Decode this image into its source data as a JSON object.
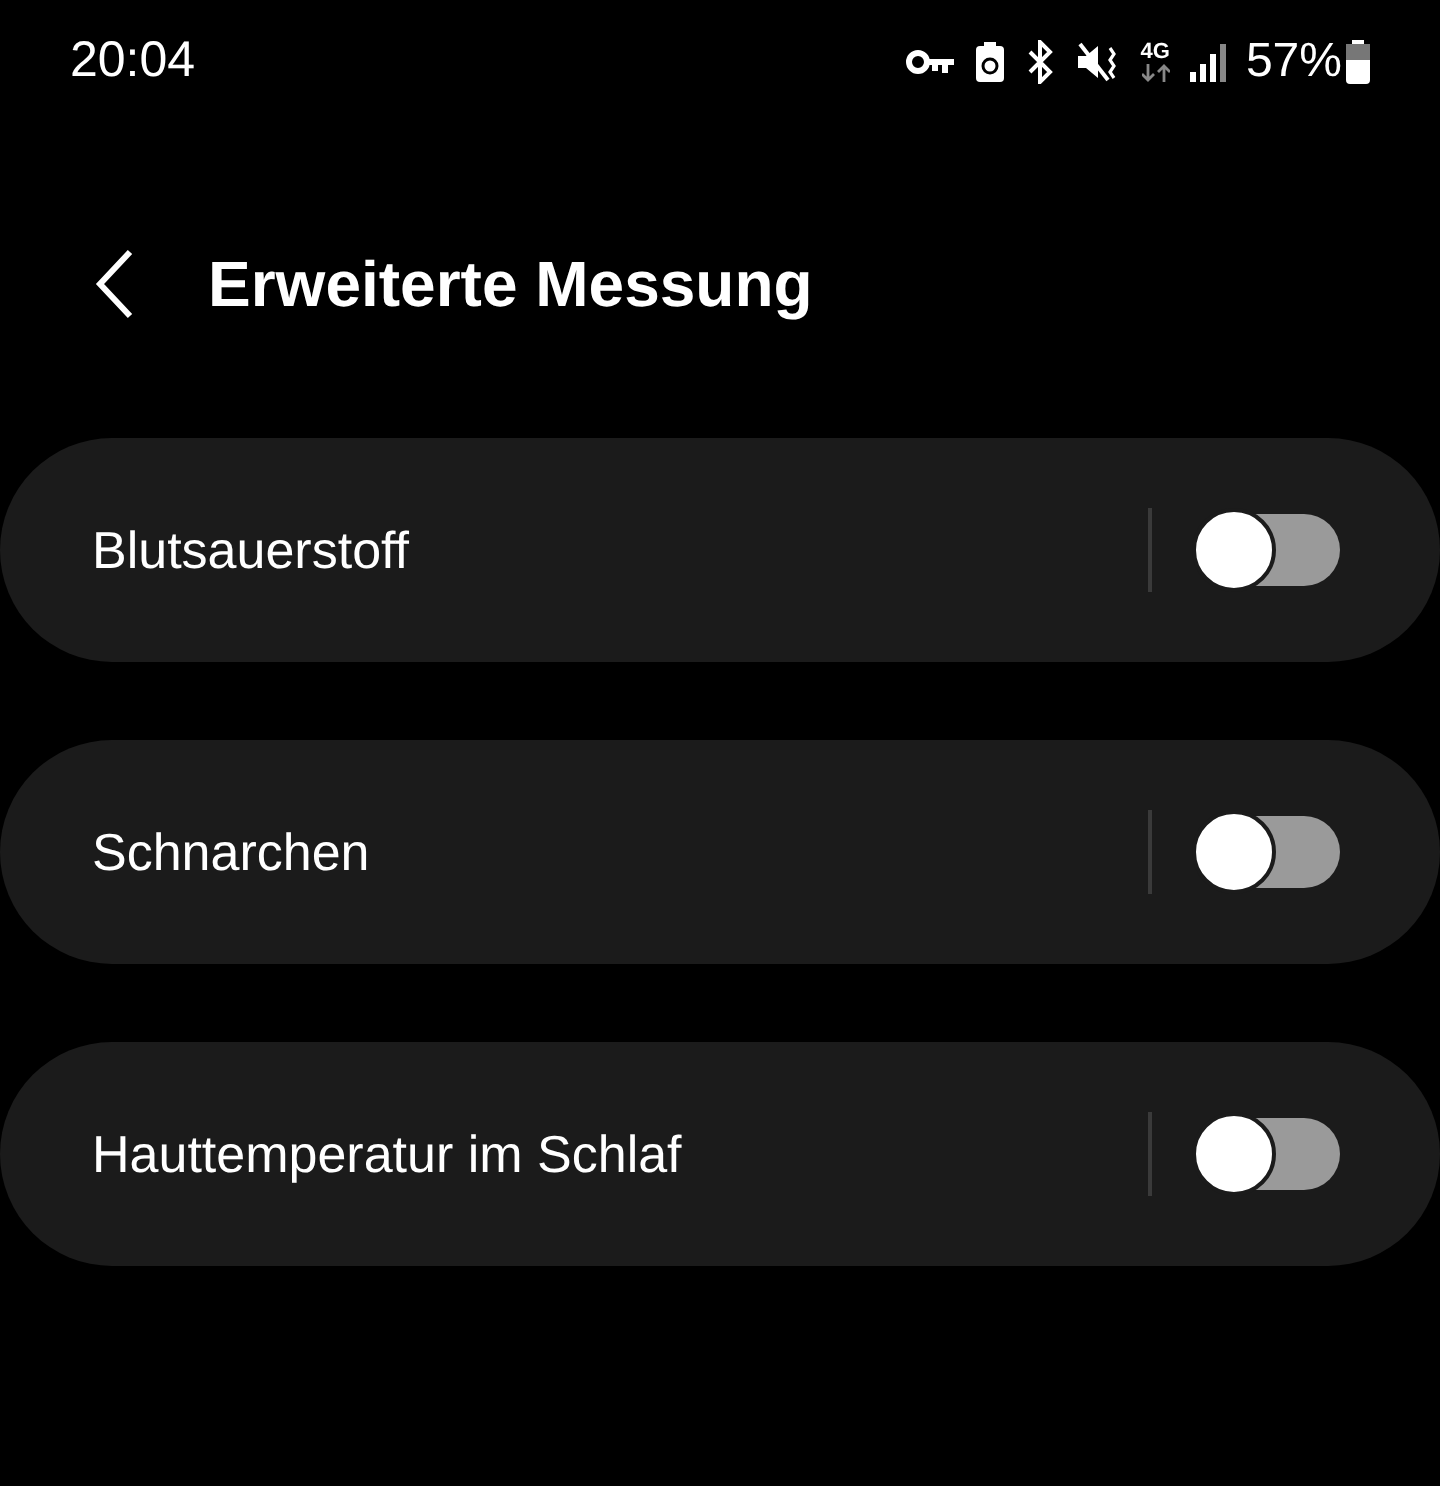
{
  "status_bar": {
    "time": "20:04",
    "network": "4G",
    "battery": "57%"
  },
  "header": {
    "title": "Erweiterte Messung"
  },
  "settings": [
    {
      "label": "Blutsauerstoff",
      "on": false
    },
    {
      "label": "Schnarchen",
      "on": false
    },
    {
      "label": "Hauttemperatur im Schlaf",
      "on": false
    }
  ]
}
